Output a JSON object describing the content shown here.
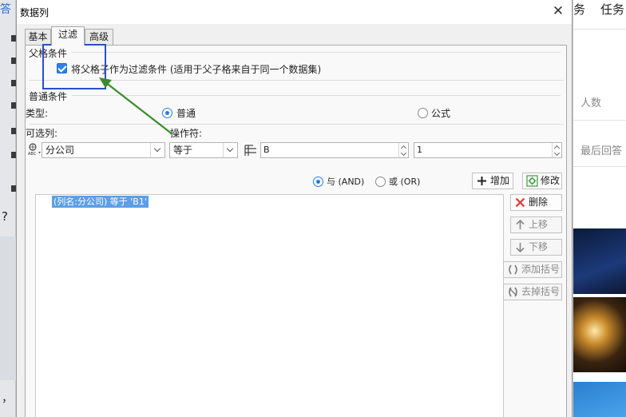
{
  "window": {
    "title": "数据列",
    "close_glyph": "✕"
  },
  "tabs": [
    {
      "label": "基本",
      "active": false
    },
    {
      "label": "过滤",
      "active": true
    },
    {
      "label": "高级",
      "active": false
    }
  ],
  "parent_condition": {
    "section_title": "父格条件",
    "checkbox_label": "将父格子作为过滤条件 (适用于父子格来自于同一个数据集)",
    "checked": true
  },
  "normal_condition": {
    "section_title": "普通条件",
    "type_label": "类型:",
    "type_options": [
      {
        "label": "普通",
        "selected": true
      },
      {
        "label": "公式",
        "selected": false
      }
    ],
    "column_label": "可选列:",
    "operator_label": "操作符:",
    "column_value": "分公司",
    "operator_value": "等于",
    "value_field_1": "B",
    "value_field_2": "1"
  },
  "logic": {
    "and_label": "与 (AND)",
    "or_label": "或 (OR)",
    "and_selected": true,
    "add_button": "增加",
    "modify_button": "修改"
  },
  "condition_list": {
    "items": [
      "(列名:分公司) 等于 'B1'"
    ]
  },
  "side_buttons": {
    "delete": "删除",
    "move_up": "上移",
    "move_down": "下移",
    "add_bracket": "添加括号",
    "remove_bracket": "去掉括号"
  },
  "background_app": {
    "nav_items": [
      "务",
      "任务"
    ],
    "right_texts": [
      "人数",
      "最后回答"
    ],
    "left_link": "答",
    "left_q": "?",
    "left_comma": "，"
  },
  "colors": {
    "accent": "#2f80e6",
    "highlight_border": "#2950c8",
    "annotation_arrow": "#3a8a2a",
    "selected_row": "#5b9fe8",
    "delete_icon": "#e53935"
  }
}
